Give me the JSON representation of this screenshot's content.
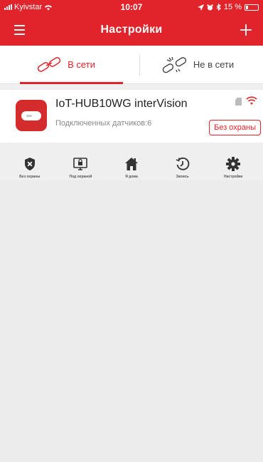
{
  "status_bar": {
    "carrier": "Kyivstar",
    "time": "10:07",
    "battery": "15 %"
  },
  "nav": {
    "title": "Настройки"
  },
  "tabs": [
    {
      "label": "В сети",
      "active": true
    },
    {
      "label": "Не в сети",
      "active": false
    }
  ],
  "device": {
    "name": "IoT-HUB10WG interVision",
    "sensors": "Подключенных датчиков:6",
    "status_button": "Без охраны"
  },
  "actions": [
    {
      "label": "Без охраны",
      "icon": "shield-x-icon"
    },
    {
      "label": "Под охраной",
      "icon": "armed-monitor-icon"
    },
    {
      "label": "Я дома",
      "icon": "home-icon"
    },
    {
      "label": "Запись",
      "icon": "history-icon"
    },
    {
      "label": "Настройки",
      "icon": "gear-icon"
    }
  ],
  "colors": {
    "accent": "#e1242c",
    "background": "#efefef"
  }
}
